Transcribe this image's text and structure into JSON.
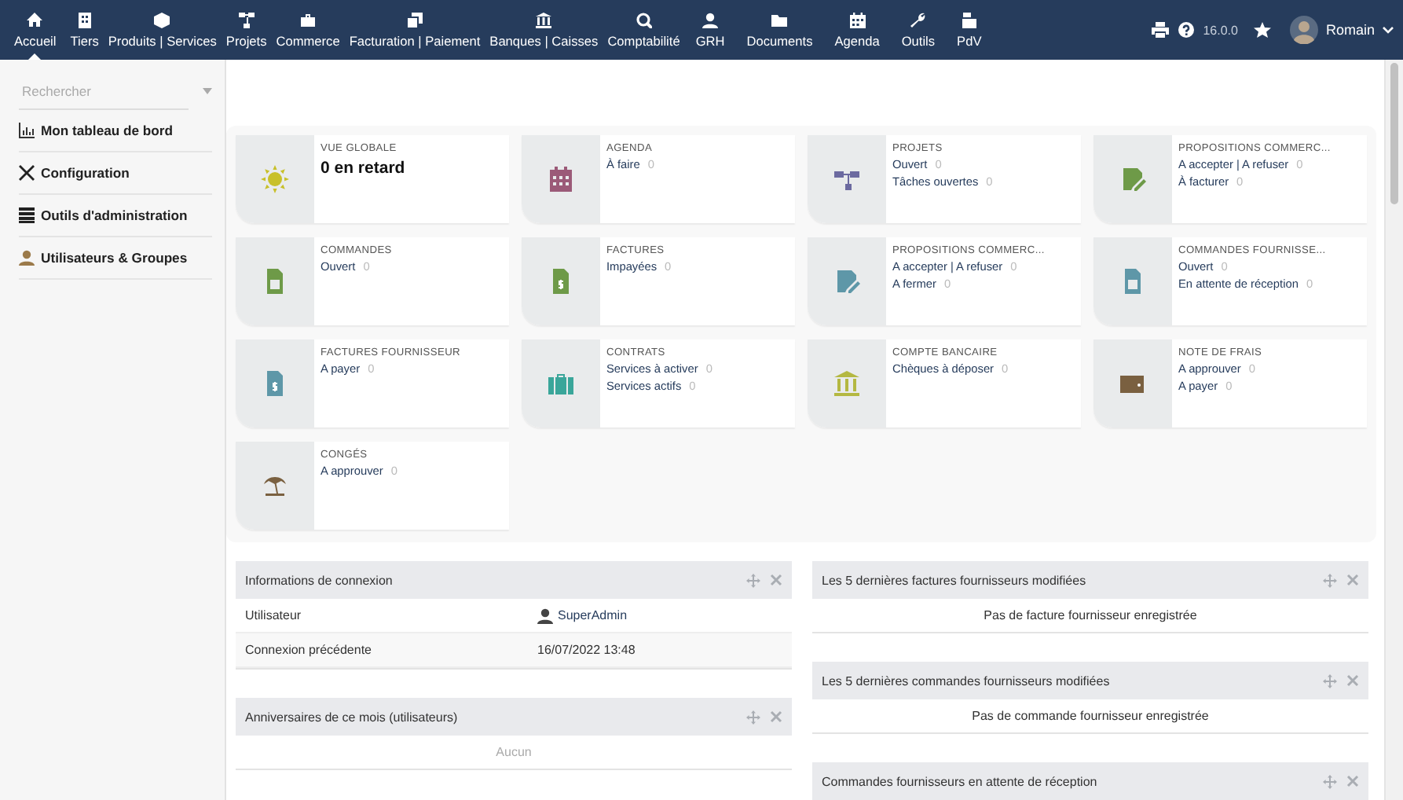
{
  "menu": [
    {
      "label": "Accueil",
      "selected": true
    },
    {
      "label": "Tiers",
      "selected": false
    },
    {
      "label": "Produits | Services",
      "selected": false
    },
    {
      "label": "Projets",
      "selected": false
    },
    {
      "label": "Commerce",
      "selected": false
    },
    {
      "label": "Facturation | Paiement",
      "selected": false
    },
    {
      "label": "Banques | Caisses",
      "selected": false
    },
    {
      "label": "Comptabilité",
      "selected": false
    },
    {
      "label": "GRH",
      "selected": false
    },
    {
      "label": "Documents",
      "selected": false
    },
    {
      "label": "Agenda",
      "selected": false
    },
    {
      "label": "Outils",
      "selected": false
    },
    {
      "label": "PdV",
      "selected": false
    }
  ],
  "topbar": {
    "version": "16.0.0",
    "user": "Romain"
  },
  "sidebar": {
    "search": {
      "placeholder": "Rechercher"
    },
    "items": [
      {
        "label": "Mon tableau de bord"
      },
      {
        "label": "Configuration"
      },
      {
        "label": "Outils d'administration"
      },
      {
        "label": "Utilisateurs & Groupes"
      }
    ]
  },
  "boxes": [
    {
      "title": "VUE GLOBALE",
      "color": "#c8c02a",
      "headline": "0 en retard"
    },
    {
      "title": "AGENDA",
      "color": "#9b5a78",
      "lines": [
        {
          "label": "À faire",
          "count": "0"
        }
      ]
    },
    {
      "title": "PROJETS",
      "color": "#6c6aa0",
      "lines": [
        {
          "label": "Ouvert",
          "count": "0"
        },
        {
          "label": "Tâches ouvertes",
          "count": "0"
        }
      ]
    },
    {
      "title": "PROPOSITIONS COMMERC...",
      "color": "#6e9a48",
      "lines": [
        {
          "label": "A accepter | A refuser",
          "count": "0"
        },
        {
          "label": "À facturer",
          "count": "0"
        }
      ]
    },
    {
      "title": "COMMANDES",
      "color": "#6e9a48",
      "lines": [
        {
          "label": "Ouvert",
          "count": "0"
        }
      ]
    },
    {
      "title": "FACTURES",
      "color": "#6e9a48",
      "lines": [
        {
          "label": "Impayées",
          "count": "0"
        }
      ]
    },
    {
      "title": "PROPOSITIONS COMMERC...",
      "color": "#5e97a8",
      "lines": [
        {
          "label": "A accepter | A refuser",
          "count": "0"
        },
        {
          "label": "A fermer",
          "count": "0"
        }
      ]
    },
    {
      "title": "COMMANDES FOURNISSE...",
      "color": "#5e97a8",
      "lines": [
        {
          "label": "Ouvert",
          "count": "0"
        },
        {
          "label": "En attente de réception",
          "count": "0"
        }
      ]
    },
    {
      "title": "FACTURES FOURNISSEUR",
      "color": "#5e97a8",
      "lines": [
        {
          "label": "A payer",
          "count": "0"
        }
      ]
    },
    {
      "title": "CONTRATS",
      "color": "#3aa69a",
      "lines": [
        {
          "label": "Services à activer",
          "count": "0"
        },
        {
          "label": "Services actifs",
          "count": "0"
        }
      ]
    },
    {
      "title": "COMPTE BANCAIRE",
      "color": "#b4b842",
      "lines": [
        {
          "label": "Chèques à déposer",
          "count": "0"
        }
      ]
    },
    {
      "title": "NOTE DE FRAIS",
      "color": "#7a6040",
      "lines": [
        {
          "label": "A approuver",
          "count": "0"
        },
        {
          "label": "A payer",
          "count": "0"
        }
      ]
    },
    {
      "title": "CONGÉS",
      "color": "#7a6040",
      "lines": [
        {
          "label": "A approuver",
          "count": "0"
        }
      ]
    }
  ],
  "widgets_left": [
    {
      "title": "Informations de connexion",
      "kind": "table",
      "rows": [
        {
          "label": "Utilisateur",
          "value": "SuperAdmin",
          "user": true
        },
        {
          "label": "Connexion précédente",
          "value": "16/07/2022 13:48",
          "user": false
        }
      ]
    },
    {
      "title": "Anniversaires de ce mois (utilisateurs)",
      "kind": "empty",
      "message": "Aucun"
    }
  ],
  "widgets_right": [
    {
      "title": "Les 5 dernières factures fournisseurs modifiées",
      "kind": "message",
      "message": "Pas de facture fournisseur enregistrée"
    },
    {
      "title": "Les 5 dernières commandes fournisseurs modifiées",
      "kind": "message",
      "message": "Pas de commande fournisseur enregistrée"
    },
    {
      "title": "Commandes fournisseurs en attente de réception",
      "kind": "message"
    }
  ]
}
